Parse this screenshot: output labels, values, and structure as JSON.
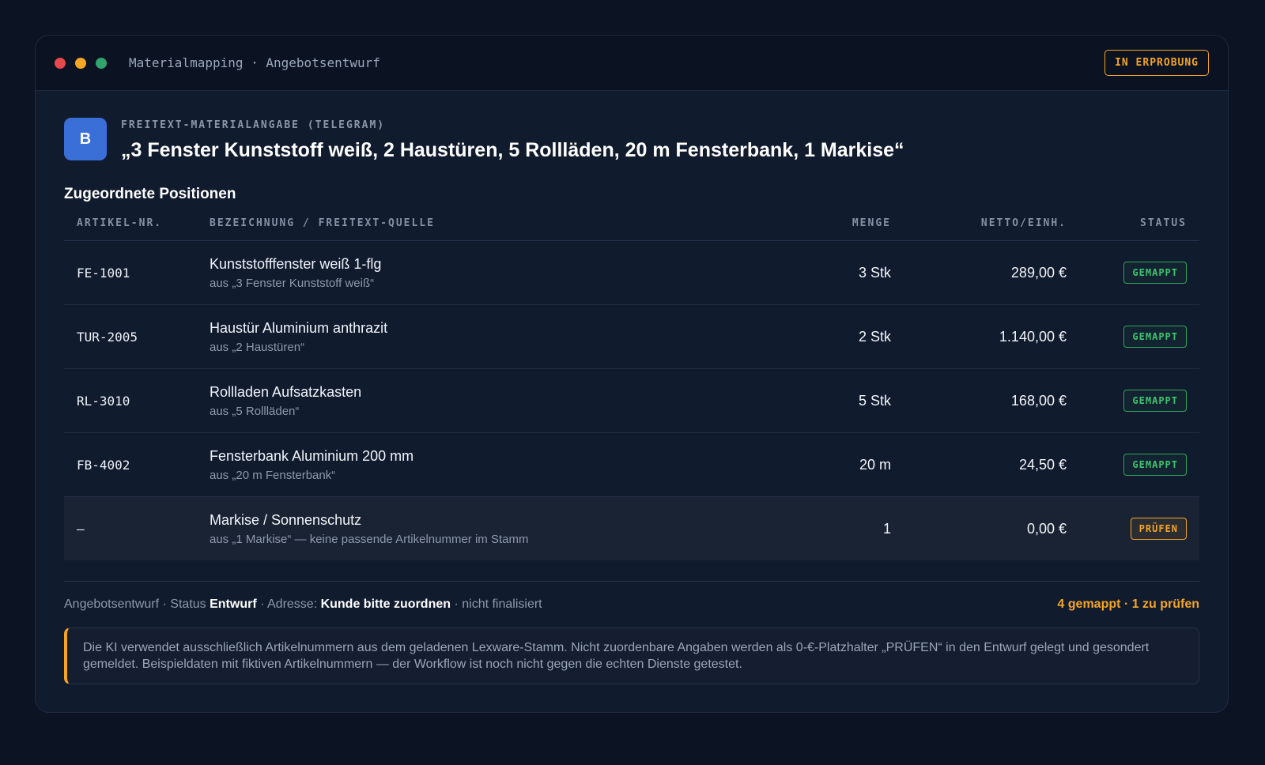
{
  "window": {
    "title": "Materialmapping · Angebotsentwurf",
    "badge": "IN ERPROBUNG"
  },
  "source": {
    "avatar_letter": "B",
    "label": "FREITEXT-MATERIALANGABE (TELEGRAM)",
    "quote": "„3 Fenster Kunststoff weiß, 2 Haustüren, 5 Rollläden, 20 m Fensterbank, 1 Markise“"
  },
  "section_title": "Zugeordnete Positionen",
  "table": {
    "headers": [
      "ARTIKEL-NR.",
      "BEZEICHNUNG / FREITEXT-QUELLE",
      "MENGE",
      "NETTO/EINH.",
      "STATUS"
    ],
    "rows": [
      {
        "artnr": "FE-1001",
        "name": "Kunststofffenster weiß 1-flg",
        "source": "aus „3 Fenster Kunststoff weiß“",
        "qty": "3 Stk",
        "price": "289,00 €",
        "status": "GEMAPPT"
      },
      {
        "artnr": "TUR-2005",
        "name": "Haustür Aluminium anthrazit",
        "source": "aus „2 Haustüren“",
        "qty": "2 Stk",
        "price": "1.140,00 €",
        "status": "GEMAPPT"
      },
      {
        "artnr": "RL-3010",
        "name": "Rollladen Aufsatzkasten",
        "source": "aus „5 Rollläden“",
        "qty": "5 Stk",
        "price": "168,00 €",
        "status": "GEMAPPT"
      },
      {
        "artnr": "FB-4002",
        "name": "Fensterbank Aluminium 200 mm",
        "source": "aus „20 m Fensterbank“",
        "qty": "20 m",
        "price": "24,50 €",
        "status": "GEMAPPT"
      },
      {
        "artnr": "–",
        "name": "Markise / Sonnenschutz",
        "source": "aus „1 Markise“ — keine passende Artikelnummer im Stamm",
        "qty": "1",
        "price": "0,00 €",
        "status": "PRÜFEN"
      }
    ]
  },
  "footer": {
    "part1": "Angebotsentwurf · Status ",
    "status_value": "Entwurf",
    "part2": " · Adresse: ",
    "address_value": "Kunde bitte zuordnen",
    "part3": " · nicht finalisiert",
    "counts": "4 gemappt · 1 zu prüfen"
  },
  "notice": "Die KI verwendet ausschließlich Artikelnummern aus dem geladenen Lexware-Stamm. Nicht zuordenbare Angaben werden als 0-€-Platzhalter „PRÜFEN“ in den Entwurf gelegt und gesondert gemeldet. Beispieldaten mit fiktiven Artikelnummern — der Workflow ist noch nicht gegen die echten Dienste getestet.",
  "colors": {
    "accent_warning": "#f5a524",
    "accent_ok": "#3cc46f",
    "avatar": "#3a6fd8",
    "background": "#0c1322"
  }
}
